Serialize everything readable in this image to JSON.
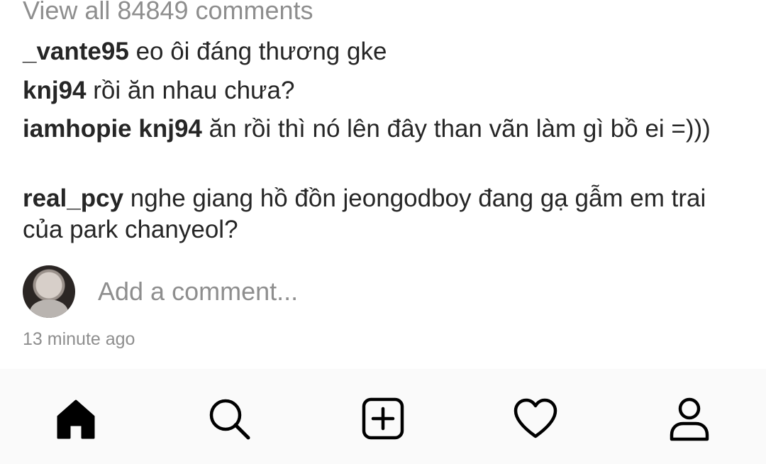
{
  "comments_section": {
    "view_all_label": "View all 84849 comments",
    "comments": [
      {
        "username": "_vante95",
        "mention": "",
        "text": "eo ôi đáng thương gke"
      },
      {
        "username": "knj94",
        "mention": "",
        "text": "rồi ăn nhau chưa?"
      },
      {
        "username": "iamhopie",
        "mention": "knj94",
        "text": "ăn rồi thì nó lên đây than vãn làm gì bồ ei =)))"
      },
      {
        "username": "real_pcy",
        "mention": "",
        "text": "nghe giang hồ đồn jeongodboy đang gạ gẫm em trai của park chanyeol?"
      }
    ]
  },
  "add_comment": {
    "placeholder": "Add a comment..."
  },
  "post_meta": {
    "timestamp": "13 minute ago"
  },
  "bottom_nav": {
    "items": [
      {
        "icon": "home-icon",
        "active": true
      },
      {
        "icon": "search-icon",
        "active": false
      },
      {
        "icon": "add-post-icon",
        "active": false
      },
      {
        "icon": "heart-icon",
        "active": false
      },
      {
        "icon": "profile-icon",
        "active": false
      }
    ]
  },
  "colors": {
    "text_primary": "#262626",
    "text_secondary": "#8e8e8e",
    "nav_background": "#fafafa"
  }
}
